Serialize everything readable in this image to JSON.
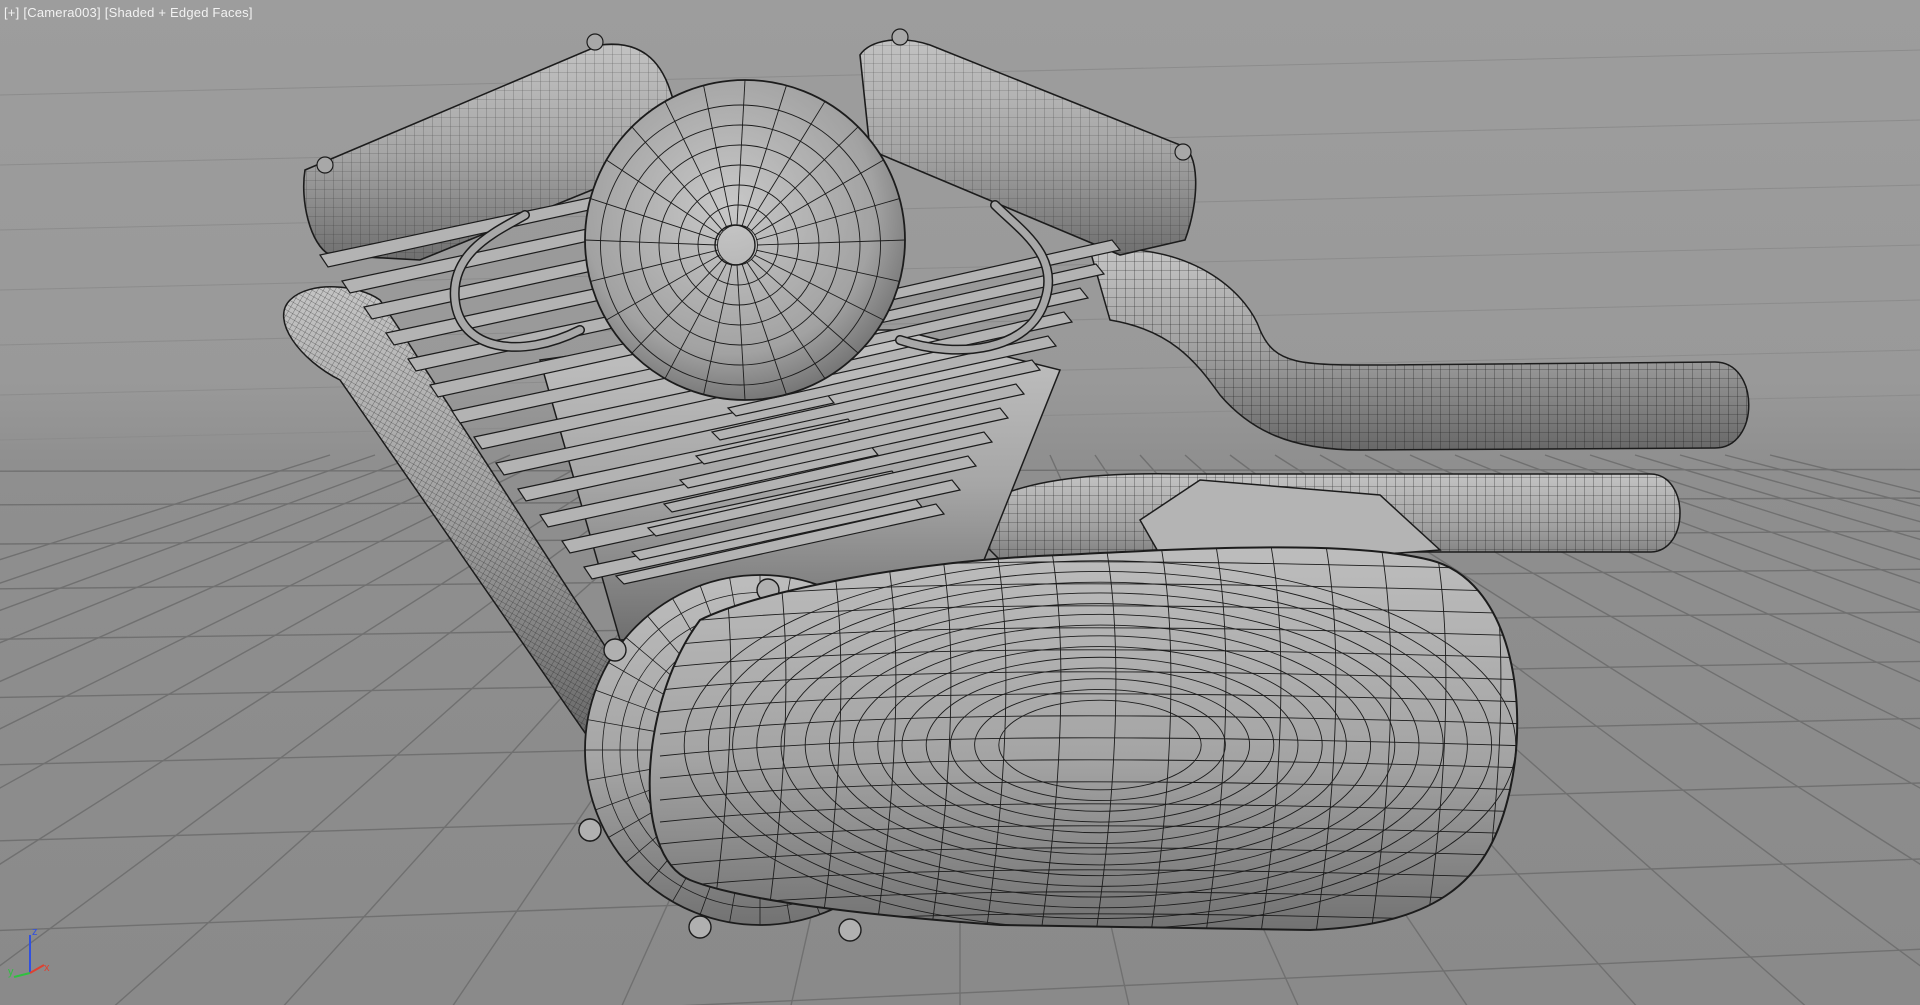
{
  "viewport": {
    "menu_plus": "[+]",
    "camera": "[Camera003]",
    "shading_mode": "[Shaded + Edged Faces]",
    "axis_labels": {
      "z": "z",
      "y": "y",
      "x": "x"
    },
    "colors": {
      "background_top": "#9d9d9d",
      "background_bottom": "#8a8a8a",
      "grid_line": "#6e6e6e",
      "mesh_fill": "#a9a9a9",
      "mesh_edge": "#1c1c1c",
      "axis_x": "#e04030",
      "axis_y": "#30c040",
      "axis_z": "#3050e0",
      "label_text": "#f2f2f2"
    },
    "object": {
      "icon": "motorcycle-v-twin-engine-icon"
    }
  }
}
